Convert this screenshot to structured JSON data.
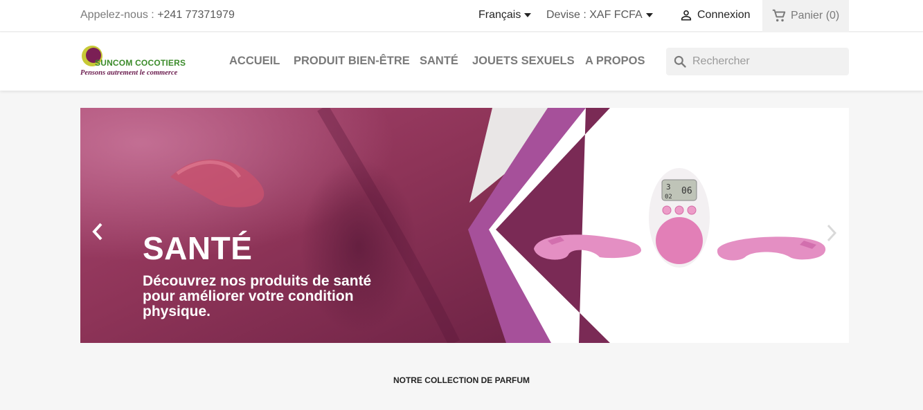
{
  "topbar": {
    "phone_label": "Appelez-nous : ",
    "phone_number": "+241 77371979",
    "language": "Français",
    "currency": "Devise : XAF FCFA",
    "login": "Connexion",
    "cart": "Panier (0)"
  },
  "header": {
    "logo_brand": "SUNCOM COCOTIERS",
    "logo_tagline": "Pensons autrement le commerce",
    "nav": [
      "ACCUEIL",
      "PRODUIT BIEN-ÊTRE",
      "SANTÉ",
      "JOUETS SEXUELS",
      "A PROPOS"
    ],
    "search_placeholder": "Rechercher"
  },
  "slider": {
    "title": "SANTÉ",
    "description": "Découvrez nos produits de santé pour améliorer votre condition physique.",
    "device_display": [
      "3",
      "06",
      "02"
    ]
  },
  "section": {
    "title": "NOTRE COLLECTION DE PARFUM"
  },
  "colors": {
    "slide_purple": "#a6509a",
    "slide_dark": "#7a2a55",
    "device_pink": "#e88bbd"
  }
}
